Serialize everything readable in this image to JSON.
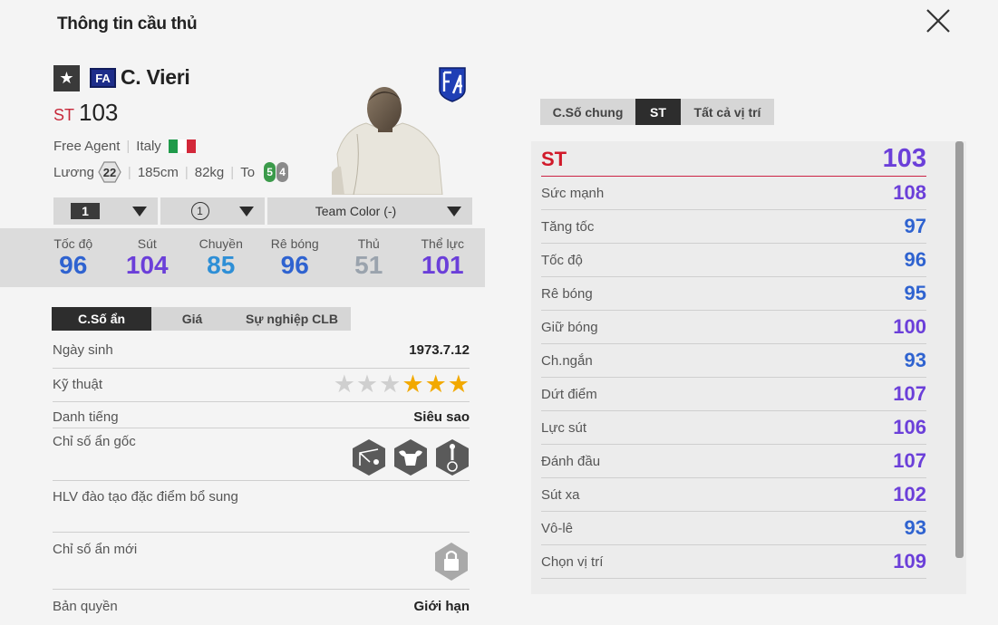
{
  "header": {
    "title": "Thông tin cầu thủ",
    "close_icon": "close-icon"
  },
  "player": {
    "star_icon": "★",
    "fa_label": "FA",
    "name": "C. Vieri",
    "position": "ST",
    "overall": "103",
    "team": "Free Agent",
    "nation": "Italy",
    "wage_label": "Lương",
    "wage": "22",
    "height": "185cm",
    "weight": "82kg",
    "body": "To",
    "right_foot": "5",
    "left_foot": "4"
  },
  "dropdowns": {
    "level": "1",
    "team_color_level": "1",
    "team_color": "Team Color (-)"
  },
  "main_stats": [
    {
      "label": "Tốc độ",
      "value": "96",
      "color": "#2f63d0"
    },
    {
      "label": "Sút",
      "value": "104",
      "color": "#6b3fd9"
    },
    {
      "label": "Chuyền",
      "value": "85",
      "color": "#2e8fd6"
    },
    {
      "label": "Rê bóng",
      "value": "96",
      "color": "#2f63d0"
    },
    {
      "label": "Thủ",
      "value": "51",
      "color": "#9aa3ad"
    },
    {
      "label": "Thể lực",
      "value": "101",
      "color": "#6b3fd9"
    }
  ],
  "left_tabs": [
    "C.Số ẩn",
    "Giá",
    "Sự nghiệp CLB"
  ],
  "details": {
    "birth_label": "Ngày sinh",
    "birth": "1973.7.12",
    "skill_label": "Kỹ thuật",
    "skill_stars": 3,
    "rep_label": "Danh tiếng",
    "rep": "Siêu sao",
    "traits_label": "Chỉ số ẩn gốc",
    "coach_label": "HLV đào tạo đặc điểm bổ sung",
    "new_label": "Chỉ số ẩn mới",
    "license_label": "Bản quyền",
    "license": "Giới hạn"
  },
  "right_tabs": [
    "C.Số chung",
    "ST",
    "Tất cả vị trí"
  ],
  "position_stats": [
    {
      "label": "ST",
      "value": "103",
      "color": "#6b3fd9"
    },
    {
      "label": "Sức mạnh",
      "value": "108",
      "color": "#6b3fd9"
    },
    {
      "label": "Tăng tốc",
      "value": "97",
      "color": "#2f63d0"
    },
    {
      "label": "Tốc độ",
      "value": "96",
      "color": "#2f63d0"
    },
    {
      "label": "Rê bóng",
      "value": "95",
      "color": "#2f63d0"
    },
    {
      "label": "Giữ bóng",
      "value": "100",
      "color": "#6b3fd9"
    },
    {
      "label": "Ch.ngắn",
      "value": "93",
      "color": "#2f63d0"
    },
    {
      "label": "Dứt điểm",
      "value": "107",
      "color": "#6b3fd9"
    },
    {
      "label": "Lực sút",
      "value": "106",
      "color": "#6b3fd9"
    },
    {
      "label": "Đánh đầu",
      "value": "107",
      "color": "#6b3fd9"
    },
    {
      "label": "Sút xa",
      "value": "102",
      "color": "#6b3fd9"
    },
    {
      "label": "Vô-lê",
      "value": "93",
      "color": "#2f63d0"
    },
    {
      "label": "Chọn vị trí",
      "value": "109",
      "color": "#6b3fd9"
    }
  ]
}
